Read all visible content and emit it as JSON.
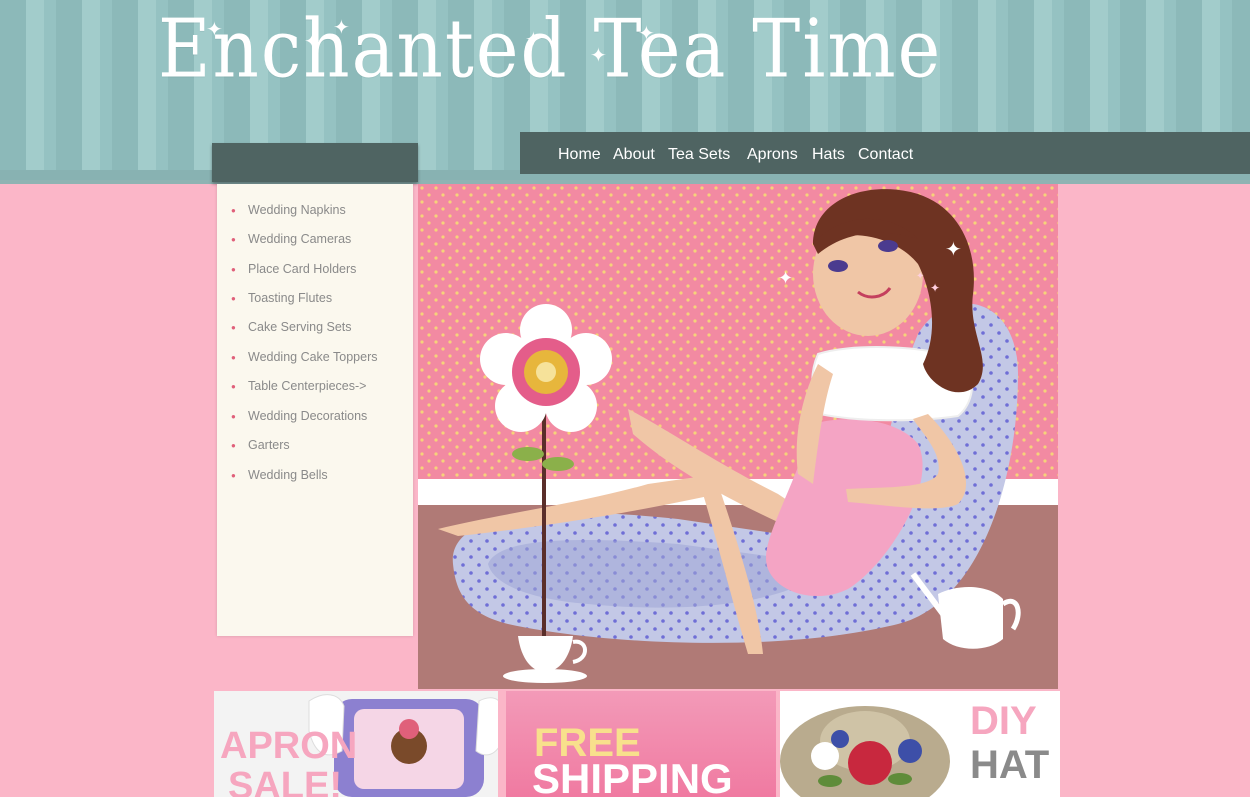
{
  "header": {
    "logo_text": "Enchanted Tea Time"
  },
  "nav": {
    "items": [
      {
        "label": "Home"
      },
      {
        "label": "About"
      },
      {
        "label": "Tea Sets"
      },
      {
        "label": "Aprons"
      },
      {
        "label": "Hats"
      },
      {
        "label": "Contact"
      }
    ]
  },
  "sidebar": {
    "items": [
      {
        "label": "Wedding Napkins"
      },
      {
        "label": "Wedding Cameras"
      },
      {
        "label": "Place Card Holders"
      },
      {
        "label": "Toasting Flutes"
      },
      {
        "label": "Cake Serving Sets"
      },
      {
        "label": "Wedding Cake Toppers"
      },
      {
        "label": "Table Centerpieces->"
      },
      {
        "label": "Wedding Decorations"
      },
      {
        "label": "Garters"
      },
      {
        "label": "Wedding Bells"
      }
    ]
  },
  "promos": {
    "apron": {
      "line1": "APRON",
      "line2": "SALE!"
    },
    "shipping": {
      "line1": "FREE",
      "line2": "SHIPPING"
    },
    "hat": {
      "line1": "DIY",
      "line2": "HAT"
    }
  },
  "colors": {
    "page_bg": "#fbb6c8",
    "nav_bg": "#4f6462",
    "header_stripe": "#8fbcbc",
    "sidebar_bg": "#fbf8ee",
    "bullet": "#e0607a"
  }
}
